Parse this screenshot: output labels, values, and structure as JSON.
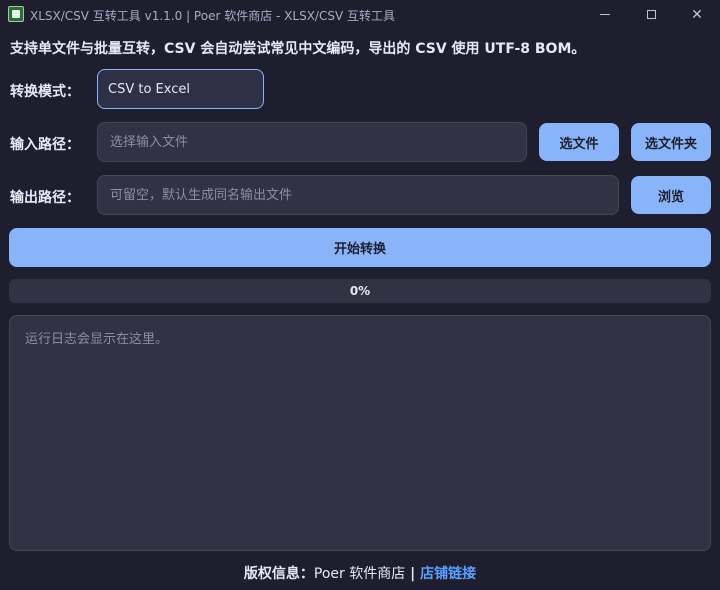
{
  "window": {
    "title": "XLSX/CSV 互转工具 v1.1.0 | Poer 软件商店 - XLSX/CSV 互转工具",
    "minimize_icon": "minimize-icon",
    "maximize_icon": "maximize-icon",
    "close_icon": "✕"
  },
  "description": "支持单文件与批量互转，CSV 会自动尝试常见中文编码，导出的 CSV 使用 UTF-8 BOM。",
  "mode": {
    "label": "转换模式：",
    "selected": "CSV to Excel"
  },
  "input": {
    "label": "输入路径：",
    "value": "",
    "placeholder": "选择输入文件",
    "choose_file_label": "选文件",
    "choose_folder_label": "选文件夹"
  },
  "output": {
    "label": "输出路径：",
    "value": "",
    "placeholder": "可留空，默认生成同名输出文件",
    "browse_label": "浏览"
  },
  "start_button_label": "开始转换",
  "progress": {
    "value": 0,
    "text": "0%"
  },
  "log": {
    "placeholder": "运行日志会显示在这里。"
  },
  "footer": {
    "prefix": "版权信息：",
    "store": "Poer 软件商店",
    "separator": " | ",
    "link_text": "店铺链接"
  },
  "colors": {
    "background": "#1e1e2e",
    "accent": "#89b4fa",
    "link": "#5aa0ff"
  }
}
